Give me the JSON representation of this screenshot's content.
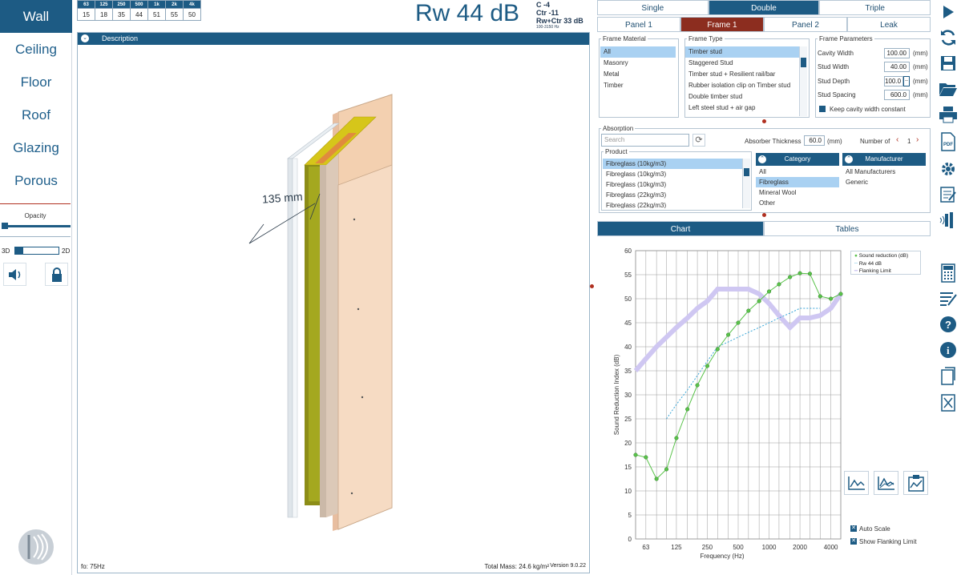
{
  "leftnav": {
    "items": [
      "Wall",
      "Ceiling",
      "Floor",
      "Roof",
      "Glazing",
      "Porous"
    ],
    "active": "Wall",
    "opacity_label": "Opacity",
    "view_left": "3D",
    "view_right": "2D"
  },
  "octave": {
    "freqs": [
      "63",
      "125",
      "250",
      "500",
      "1k",
      "2k",
      "4k"
    ],
    "values": [
      "15",
      "18",
      "35",
      "44",
      "51",
      "55",
      "50"
    ]
  },
  "rating": {
    "main": "Rw 44 dB",
    "c": "C -4",
    "ctr": "Ctr -11",
    "rwctr": "Rw+Ctr 33 dB",
    "range": "100-3150 Hz"
  },
  "viewport": {
    "desc": "Description",
    "dimension": "135 mm",
    "fo": "fo: 75Hz",
    "mass": "Total Mass: 24.6 kg/m²",
    "version": "Version 9.0.22"
  },
  "config_tabs": [
    "Single",
    "Double",
    "Triple"
  ],
  "config_active": "Double",
  "panel_tabs": [
    "Panel 1",
    "Frame 1",
    "Panel 2",
    "Leak"
  ],
  "panel_active": "Frame 1",
  "frame_material": {
    "legend": "Frame Material",
    "items": [
      "All",
      "Masonry",
      "Metal",
      "Timber"
    ],
    "selected": "All"
  },
  "frame_type": {
    "legend": "Frame Type",
    "items": [
      "Timber stud",
      "Staggered Stud",
      "Timber stud + Resilient rail/bar",
      "Rubber isolation clip on Timber stud",
      "Double timber stud",
      "Left steel stud + air gap"
    ],
    "selected": "Timber stud"
  },
  "frame_params": {
    "legend": "Frame Parameters",
    "rows": [
      {
        "label": "Cavity Width",
        "value": "100.00",
        "unit": "(mm)"
      },
      {
        "label": "Stud Width",
        "value": "40.00",
        "unit": "(mm)"
      },
      {
        "label": "Stud Depth",
        "value": "100.0",
        "unit": "(mm)"
      },
      {
        "label": "Stud Spacing",
        "value": "600.0",
        "unit": "(mm)"
      }
    ],
    "keep_label": "Keep cavity width constant"
  },
  "absorption": {
    "legend": "Absorption",
    "search_placeholder": "Search",
    "thickness_label": "Absorber Thickness",
    "thickness_value": "60.0",
    "thickness_unit": "(mm)",
    "number_label": "Number of",
    "number_value": "1",
    "product_legend": "Product",
    "products": [
      "Fibreglass (10kg/m3)",
      "Fibreglass (10kg/m3)",
      "Fibreglass (10kg/m3)",
      "Fibreglass (22kg/m3)",
      "Fibreglass (22kg/m3)"
    ],
    "category_header": "Category",
    "categories": [
      "All",
      "Fibreglass",
      "Mineral Wool",
      "Other"
    ],
    "category_selected": "Fibreglass",
    "manufacturer_header": "Manufacturer",
    "manufacturers": [
      "All Manufacturers",
      "Generic"
    ]
  },
  "view_tabs": [
    "Chart",
    "Tables"
  ],
  "view_active": "Chart",
  "chart_controls": {
    "auto_scale": "Auto Scale",
    "show_flanking": "Show Flanking Limit"
  },
  "chart_data": {
    "type": "line",
    "xlabel": "Frequency (Hz)",
    "ylabel": "Sound Reduction Index (dB)",
    "ylim": [
      0,
      60
    ],
    "yticks": [
      0,
      5,
      10,
      15,
      20,
      25,
      30,
      35,
      40,
      45,
      50,
      55,
      60
    ],
    "xticks": [
      {
        "label": "63",
        "f": 63
      },
      {
        "label": "125",
        "f": 125
      },
      {
        "label": "250",
        "f": 250
      },
      {
        "label": "500",
        "f": 500
      },
      {
        "label": "1000",
        "f": 1000
      },
      {
        "label": "2000",
        "f": 2000
      },
      {
        "label": "4000",
        "f": 4000
      }
    ],
    "xlim": [
      50,
      5000
    ],
    "legend_position": "top-right",
    "grid": true,
    "series": [
      {
        "name": "Sound reduction (dB)",
        "color": "#59c24a",
        "marker": true,
        "x": [
          50,
          63,
          80,
          100,
          125,
          160,
          200,
          250,
          315,
          400,
          500,
          630,
          800,
          1000,
          1250,
          1600,
          2000,
          2500,
          3150,
          4000,
          5000
        ],
        "y": [
          17.5,
          17,
          12.5,
          14.5,
          21,
          27,
          32,
          36,
          39.5,
          42.5,
          45,
          47.5,
          49.5,
          51.5,
          53,
          54.5,
          55.3,
          55.2,
          50.5,
          50,
          51
        ]
      },
      {
        "name": "Rw 44 dB",
        "color": "#38a6d8",
        "dashed": true,
        "x": [
          100,
          125,
          160,
          200,
          250,
          315,
          400,
          500,
          630,
          800,
          1000,
          1250,
          1600,
          2000,
          2500,
          3150
        ],
        "y": [
          25,
          28,
          31,
          34,
          37,
          40,
          41,
          42,
          43,
          44,
          45,
          46,
          47,
          48,
          48,
          48
        ]
      },
      {
        "name": "Flanking Limit",
        "color": "#cfc7f2",
        "thick": true,
        "x": [
          50,
          63,
          80,
          100,
          125,
          160,
          200,
          250,
          315,
          400,
          500,
          630,
          800,
          1000,
          1250,
          1600,
          2000,
          2500,
          3150,
          4000,
          5000
        ],
        "y": [
          35,
          37.5,
          40,
          42,
          44,
          46,
          48,
          49.5,
          52,
          52,
          52,
          52,
          51,
          49,
          46.5,
          44,
          46,
          46,
          46.5,
          48,
          51
        ]
      }
    ]
  }
}
